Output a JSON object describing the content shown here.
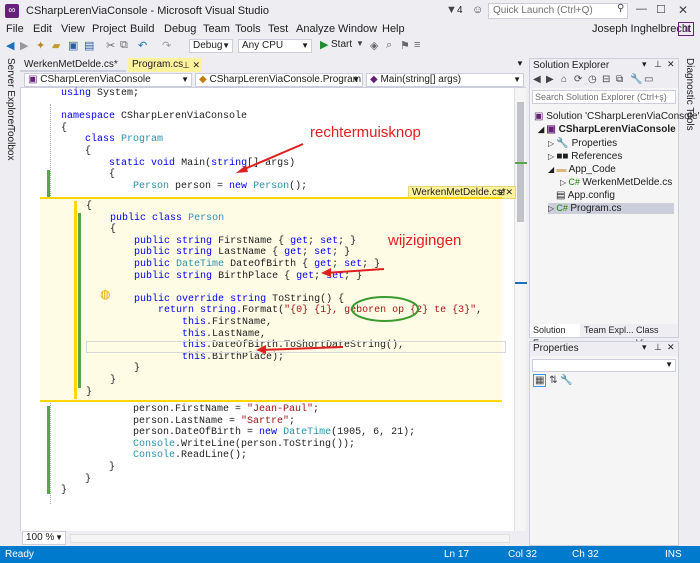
{
  "window": {
    "title": "CSharpLerenViaConsole - Microsoft Visual Studio",
    "notifications": "4",
    "quick_launch_placeholder": "Quick Launch (Ctrl+Q)",
    "user": "Joseph Inghelbrecht",
    "user_initials": "JI"
  },
  "menu": [
    "File",
    "Edit",
    "View",
    "Project",
    "Build",
    "Debug",
    "Team",
    "Tools",
    "Test",
    "Analyze",
    "Window",
    "Help"
  ],
  "toolbar": {
    "config": "Debug",
    "platform": "Any CPU",
    "start_label": "Start"
  },
  "left_strip": [
    "Server Explorer",
    "Toolbox"
  ],
  "right_strip": [
    "Diagnostic Tools"
  ],
  "tabs": [
    {
      "label": "WerkenMetDelde.cs*"
    },
    {
      "label": "Program.cs"
    }
  ],
  "nav": {
    "project": "CSharpLerenViaConsole",
    "class": "CSharpLerenViaConsole.Program",
    "member": "Main(string[] args)"
  },
  "peek_tab": "WerkenMetDelde.cs*",
  "annotations": {
    "right_click": "rechtermuisknop",
    "changes": "wijzigingen"
  },
  "zoom": "100 %",
  "status": {
    "ready": "Ready",
    "ln": "Ln 17",
    "col": "Col 32",
    "ch": "Ch 32",
    "mode": "INS"
  },
  "solution_explorer": {
    "title": "Solution Explorer",
    "search_placeholder": "Search Solution Explorer (Ctrl+ş)",
    "items": [
      "Solution 'CSharpLerenViaConsole'",
      "CSharpLerenViaConsole",
      "Properties",
      "References",
      "App_Code",
      "WerkenMetDelde.cs",
      "App.config",
      "Program.cs"
    ],
    "tabs": [
      "Solution E...",
      "Team Expl...",
      "Class View"
    ]
  },
  "properties": {
    "title": "Properties"
  },
  "code_top": [
    [
      {
        "t": "using",
        "c": "kw"
      },
      {
        "t": " System;"
      }
    ],
    [
      {
        "t": ""
      }
    ],
    [
      {
        "t": "namespace",
        "c": "kw"
      },
      {
        "t": " CSharpLerenViaConsole"
      }
    ],
    [
      {
        "t": "{"
      }
    ],
    [
      {
        "t": "    "
      },
      {
        "t": "class",
        "c": "kw"
      },
      {
        "t": " "
      },
      {
        "t": "Program",
        "c": "ty"
      }
    ],
    [
      {
        "t": "    {"
      }
    ],
    [
      {
        "t": "        "
      },
      {
        "t": "static",
        "c": "kw"
      },
      {
        "t": " "
      },
      {
        "t": "void",
        "c": "kw"
      },
      {
        "t": " Main("
      },
      {
        "t": "string",
        "c": "kw"
      },
      {
        "t": "[] args)"
      }
    ],
    [
      {
        "t": "        {"
      }
    ],
    [
      {
        "t": "            "
      },
      {
        "t": "Person",
        "c": "ty"
      },
      {
        "t": " person = "
      },
      {
        "t": "new",
        "c": "kw"
      },
      {
        "t": " "
      },
      {
        "t": "Person",
        "c": "ty"
      },
      {
        "t": "();"
      }
    ]
  ],
  "code_peek": [
    [
      {
        "t": "{"
      }
    ],
    [
      {
        "t": "    "
      },
      {
        "t": "public",
        "c": "kw"
      },
      {
        "t": " "
      },
      {
        "t": "class",
        "c": "kw"
      },
      {
        "t": " "
      },
      {
        "t": "Person",
        "c": "ty"
      }
    ],
    [
      {
        "t": "    {"
      }
    ],
    [
      {
        "t": "        "
      },
      {
        "t": "public",
        "c": "kw"
      },
      {
        "t": " "
      },
      {
        "t": "string",
        "c": "kw"
      },
      {
        "t": " FirstName { "
      },
      {
        "t": "get",
        "c": "kw"
      },
      {
        "t": "; "
      },
      {
        "t": "set",
        "c": "kw"
      },
      {
        "t": "; }"
      }
    ],
    [
      {
        "t": "        "
      },
      {
        "t": "public",
        "c": "kw"
      },
      {
        "t": " "
      },
      {
        "t": "string",
        "c": "kw"
      },
      {
        "t": " LastName { "
      },
      {
        "t": "get",
        "c": "kw"
      },
      {
        "t": "; "
      },
      {
        "t": "set",
        "c": "kw"
      },
      {
        "t": "; }"
      }
    ],
    [
      {
        "t": "        "
      },
      {
        "t": "public",
        "c": "kw"
      },
      {
        "t": " "
      },
      {
        "t": "DateTime",
        "c": "ty"
      },
      {
        "t": " DateOfBirth { "
      },
      {
        "t": "get",
        "c": "kw"
      },
      {
        "t": "; "
      },
      {
        "t": "set",
        "c": "kw"
      },
      {
        "t": "; }"
      }
    ],
    [
      {
        "t": "        "
      },
      {
        "t": "public",
        "c": "kw"
      },
      {
        "t": " "
      },
      {
        "t": "string",
        "c": "kw"
      },
      {
        "t": " BirthPlace { "
      },
      {
        "t": "get",
        "c": "kw"
      },
      {
        "t": "; "
      },
      {
        "t": "set",
        "c": "kw"
      },
      {
        "t": "; }"
      }
    ],
    [
      {
        "t": ""
      }
    ],
    [
      {
        "t": "        "
      },
      {
        "t": "public",
        "c": "kw"
      },
      {
        "t": " "
      },
      {
        "t": "override",
        "c": "kw"
      },
      {
        "t": " "
      },
      {
        "t": "string",
        "c": "kw"
      },
      {
        "t": " ToString() {"
      }
    ],
    [
      {
        "t": "            "
      },
      {
        "t": "return",
        "c": "kw"
      },
      {
        "t": " "
      },
      {
        "t": "string",
        "c": "kw"
      },
      {
        "t": ".Format("
      },
      {
        "t": "\"{0} {1}, geboren op {2} te {3}\"",
        "c": "st"
      },
      {
        "t": ","
      }
    ],
    [
      {
        "t": "                "
      },
      {
        "t": "this",
        "c": "kw"
      },
      {
        "t": ".FirstName,"
      }
    ],
    [
      {
        "t": "                "
      },
      {
        "t": "this",
        "c": "kw"
      },
      {
        "t": ".LastName,"
      }
    ],
    [
      {
        "t": "                "
      },
      {
        "t": "this",
        "c": "kw"
      },
      {
        "t": ".DateOfBirth.ToShortDateString(),"
      }
    ],
    [
      {
        "t": "                "
      },
      {
        "t": "this",
        "c": "kw"
      },
      {
        "t": ".BirthPlace);"
      }
    ],
    [
      {
        "t": "        }"
      }
    ],
    [
      {
        "t": "    }"
      }
    ],
    [
      {
        "t": "}"
      }
    ]
  ],
  "code_bottom": [
    [
      {
        "t": "            person.FirstName = "
      },
      {
        "t": "\"Jean-Paul\"",
        "c": "st"
      },
      {
        "t": ";"
      }
    ],
    [
      {
        "t": "            person.LastName = "
      },
      {
        "t": "\"Sartre\"",
        "c": "st"
      },
      {
        "t": ";"
      }
    ],
    [
      {
        "t": "            person.DateOfBirth = "
      },
      {
        "t": "new",
        "c": "kw"
      },
      {
        "t": " "
      },
      {
        "t": "DateTime",
        "c": "ty"
      },
      {
        "t": "(1905, 6, 21);"
      }
    ],
    [
      {
        "t": "            "
      },
      {
        "t": "Console",
        "c": "ty"
      },
      {
        "t": ".WriteLine(person.ToString());"
      }
    ],
    [
      {
        "t": "            "
      },
      {
        "t": "Console",
        "c": "ty"
      },
      {
        "t": ".ReadLine();"
      }
    ],
    [
      {
        "t": "        }"
      }
    ],
    [
      {
        "t": "    }"
      }
    ],
    [
      {
        "t": "}"
      }
    ]
  ]
}
